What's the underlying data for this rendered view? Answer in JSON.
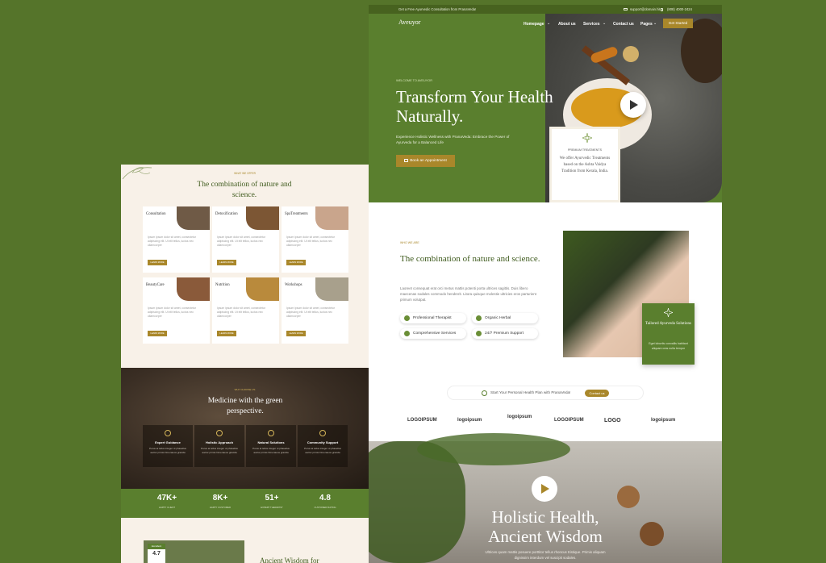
{
  "right": {
    "topbar": {
      "promo": "Get a Free Ayurvedic Consultation from PranaVeda!",
      "email": "support@domain.hit",
      "phone": "(808) 4000-2424"
    },
    "nav": {
      "logo": "Aveuyor",
      "items": [
        "Homepage",
        "About us",
        "Services",
        "Contact us",
        "Pages"
      ],
      "cta": "Get Started"
    },
    "hero": {
      "eyebrow": "WELCOME TO AVEUYOR",
      "title": "Transform Your Health Naturally.",
      "subtitle": "Experience Holistic Wellness with PranaVeda: Embrace the Power of Ayurveda for a Balanced Life",
      "button": "Book an Appointment",
      "card_label": "PREMIUM TREATMENTS",
      "card_text": "We offer Ayurvedic Treatments based on the Ashta Vaidya Tradition from Kerala, India."
    },
    "about": {
      "eyebrow": "WHO WE ARE",
      "title": "The combination of nature and science.",
      "body": "Laoreet consequat erat orci metus mattis potenti porta ultrices sagittis. Duis libero maecenas sodales commodo hendrerit. Litora quisque molestie ultricies eros parturient primum volutpat.",
      "features": [
        "Professional Therapist",
        "Organic Herbal",
        "Comprehensive Services",
        "24/7 Premium Support"
      ],
      "badge_title": "Tailored Ayurveda Solutions",
      "badge_text": "Eget lobortis convallis habitant aliquam cras nulla tempor",
      "plan_text": "Start Your Personal Health Plan with PranaVeda!",
      "plan_button": "Contact us"
    },
    "logos": [
      "LOGOIPSUM",
      "logoipsum",
      "logoipsum",
      "LOGOIPSUM",
      "LOGO",
      "logoipsum"
    ],
    "video": {
      "title_line1": "Holistic Health,",
      "title_line2": "Ancient Wisdom",
      "text": "Ultrices quam mattis posuere porttitor tellus rhoncus tristique. Primis aliquam dignissim interdum vel suscipit sodales."
    }
  },
  "left": {
    "eyebrow": "WHAT WE OFFER",
    "title": "The combination of nature and science.",
    "services": [
      {
        "title": "Consultation",
        "text": "Ipsum ipsum dolor sit amet, consectetur adipiscing elit. Ut elit tellus, luctus nec ullamcorper",
        "button": "LEARN MORE",
        "color": "#6f5a46"
      },
      {
        "title": "Detoxification",
        "text": "Ipsum ipsum dolor sit amet, consectetur adipiscing elit. Ut elit tellus, luctus nec ullamcorper",
        "button": "LEARN MORE",
        "color": "#7c5634"
      },
      {
        "title": "SpaTreatments",
        "text": "Ipsum ipsum dolor sit amet, consectetur adipiscing elit. Ut elit tellus, luctus nec ullamcorper",
        "button": "LEARN MORE",
        "color": "#c9a58c"
      },
      {
        "title": "BeautyCare",
        "text": "Ipsum ipsum dolor sit amet, consectetur adipiscing elit. Ut elit tellus, luctus nec ullamcorper",
        "button": "LEARN MORE",
        "color": "#8a5a3a"
      },
      {
        "title": "Nutrition",
        "text": "Ipsum ipsum dolor sit amet, consectetur adipiscing elit. Ut elit tellus, luctus nec ullamcorper",
        "button": "LEARN MORE",
        "color": "#b98a3c"
      },
      {
        "title": "Workshops",
        "text": "Ipsum ipsum dolor sit amet, consectetur adipiscing elit. Ut elit tellus, luctus nec ullamcorper",
        "button": "LEARN MORE",
        "color": "#a8a08c"
      }
    ],
    "medicine": {
      "eyebrow": "WHY CHOOSE US",
      "title": "Medicine with the green perspective.",
      "features": [
        {
          "title": "Expert Guidance",
          "text": "Purus at tellus integer ut phasellus auctor primis himenaeos gravida"
        },
        {
          "title": "Holistic Approach",
          "text": "Purus at tellus integer ut phasellus auctor primis himenaeos gravida"
        },
        {
          "title": "Natural Solutions",
          "text": "Purus at tellus integer ut phasellus auctor primis himenaeos gravida"
        },
        {
          "title": "Community Support",
          "text": "Purus at tellus integer ut phasellus auctor primis himenaeos gravida"
        }
      ]
    },
    "stats": [
      {
        "value": "47K+",
        "label": "HAPPY CLIENT"
      },
      {
        "value": "8K+",
        "label": "HAPPY CUSTOMER"
      },
      {
        "value": "51+",
        "label": "EXPERT THERAPIST"
      },
      {
        "value": "4.8",
        "label": "CUSTOMER RATING"
      }
    ],
    "bottom": {
      "tag": "Excellent",
      "rating": "4.7",
      "title": "Ancient Wisdom for"
    }
  },
  "colors": {
    "background": "#55742a",
    "primary_green": "#5a7f2e",
    "gold": "#a9872a",
    "cream": "#f8f1e8"
  }
}
